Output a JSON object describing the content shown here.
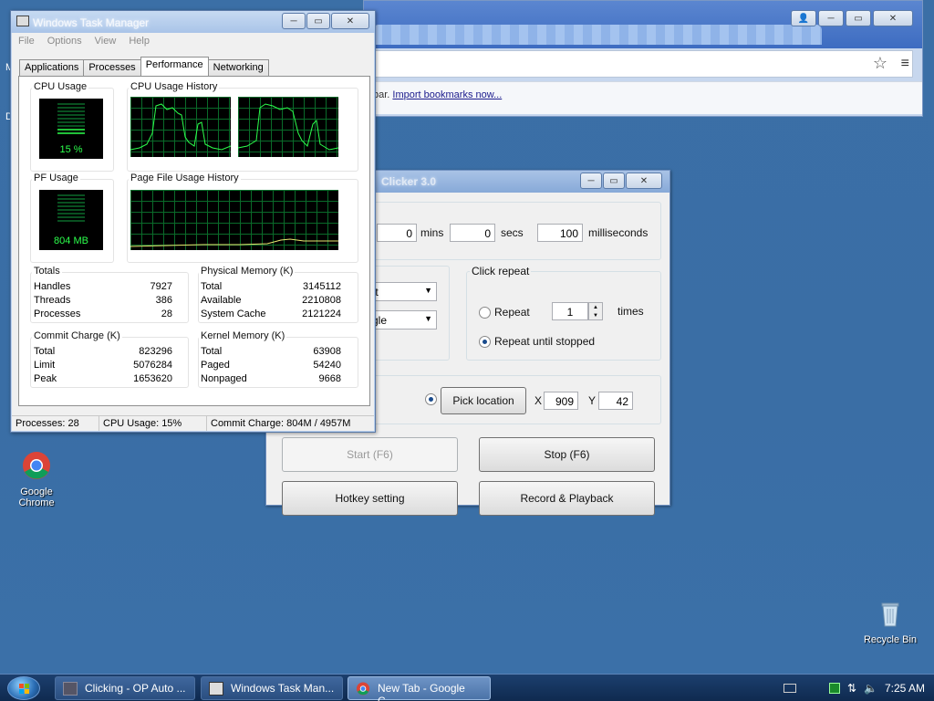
{
  "desktop": {
    "icons": [
      {
        "label": "Google Chrome"
      },
      {
        "label": "Recycle Bin"
      }
    ]
  },
  "chrome": {
    "bookmark_text": "bar.",
    "import_link": "Import bookmarks now..."
  },
  "clicker": {
    "title": "Clicker 3.0",
    "interval": {
      "mins": "0",
      "mins_label": "mins",
      "secs": "0",
      "secs_label": "secs",
      "ms": "100",
      "ms_label": "milliseconds",
      "hours_partial": "0"
    },
    "click_options": {
      "button_partial": "ft",
      "type_partial": "gle"
    },
    "click_repeat": {
      "label": "Click repeat",
      "repeat_label": "Repeat",
      "repeat_times": "1",
      "times_label": "times",
      "until_stopped_label": "Repeat until stopped",
      "selected": "until_stopped"
    },
    "location": {
      "pick_label": "Pick location",
      "x_label": "X",
      "x": "909",
      "y_label": "Y",
      "y": "42"
    },
    "buttons": {
      "start": "Start (F6)",
      "stop": "Stop (F6)",
      "hotkey": "Hotkey setting",
      "record": "Record & Playback"
    }
  },
  "taskmgr": {
    "title": "Windows Task Manager",
    "menu": [
      "File",
      "Options",
      "View",
      "Help"
    ],
    "tabs": [
      "Applications",
      "Processes",
      "Performance",
      "Networking"
    ],
    "active_tab": "Performance",
    "cpu_usage_label": "CPU Usage",
    "cpu_usage_value": "15 %",
    "cpu_history_label": "CPU Usage History",
    "pf_usage_label": "PF Usage",
    "pf_usage_value": "804 MB",
    "pf_history_label": "Page File Usage History",
    "totals": {
      "label": "Totals",
      "rows": [
        [
          "Handles",
          "7927"
        ],
        [
          "Threads",
          "386"
        ],
        [
          "Processes",
          "28"
        ]
      ]
    },
    "physical": {
      "label": "Physical Memory (K)",
      "rows": [
        [
          "Total",
          "3145112"
        ],
        [
          "Available",
          "2210808"
        ],
        [
          "System Cache",
          "2121224"
        ]
      ]
    },
    "commit": {
      "label": "Commit Charge (K)",
      "rows": [
        [
          "Total",
          "823296"
        ],
        [
          "Limit",
          "5076284"
        ],
        [
          "Peak",
          "1653620"
        ]
      ]
    },
    "kernel": {
      "label": "Kernel Memory (K)",
      "rows": [
        [
          "Total",
          "63908"
        ],
        [
          "Paged",
          "54240"
        ],
        [
          "Nonpaged",
          "9668"
        ]
      ]
    },
    "status": {
      "processes": "Processes: 28",
      "cpu": "CPU Usage: 15%",
      "commit": "Commit Charge: 804M / 4957M"
    }
  },
  "taskbar": {
    "buttons": [
      "Clicking - OP Auto ...",
      "Windows Task Man...",
      "New Tab - Google C..."
    ],
    "active_index": 2,
    "clock": "7:25 AM"
  }
}
